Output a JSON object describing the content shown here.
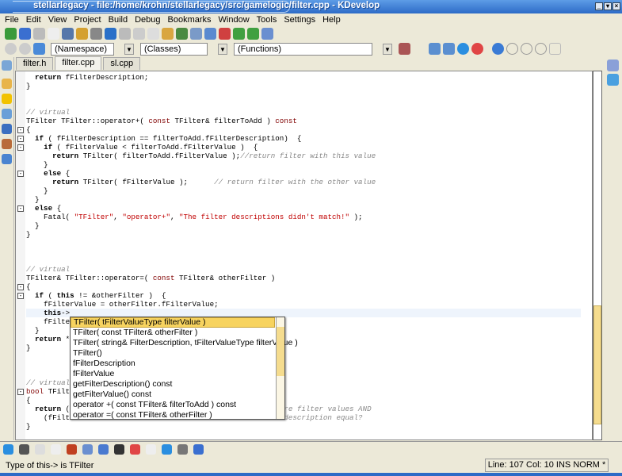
{
  "window": {
    "title": "stellarlegacy - file:/home/krohn/stellarlegacy/src/gamelogic/filter.cpp - KDevelop"
  },
  "menu": [
    "File",
    "Edit",
    "View",
    "Project",
    "Build",
    "Debug",
    "Bookmarks",
    "Window",
    "Tools",
    "Settings",
    "Help"
  ],
  "toolbar2": {
    "namespace": "(Namespace)",
    "classes": "(Classes)",
    "functions": "(Functions)"
  },
  "tabs": [
    {
      "label": "filter.h"
    },
    {
      "label": "filter.cpp",
      "active": true
    },
    {
      "label": "sl.cpp"
    }
  ],
  "code": [
    [
      [
        "  ",
        "pl"
      ],
      [
        "return",
        "kw"
      ],
      [
        " fFilterDescription;",
        "pl"
      ]
    ],
    [
      [
        "}",
        "pl"
      ]
    ],
    [],
    [],
    [
      [
        "// virtual",
        "cm"
      ]
    ],
    [
      [
        "TFilter TFilter::operator+( ",
        "pl"
      ],
      [
        "const",
        "ty"
      ],
      [
        " TFilter& filterToAdd ) ",
        "pl"
      ],
      [
        "const",
        "ty"
      ]
    ],
    [
      [
        "{",
        "pl"
      ]
    ],
    [
      [
        "  ",
        "pl"
      ],
      [
        "if",
        "kw"
      ],
      [
        " ( fFilterDescription == filterToAdd.fFilterDescription)  {",
        "pl"
      ]
    ],
    [
      [
        "    ",
        "pl"
      ],
      [
        "if",
        "kw"
      ],
      [
        " ( fFilterValue < filterToAdd.fFilterValue )  {",
        "pl"
      ]
    ],
    [
      [
        "      ",
        "pl"
      ],
      [
        "return",
        "kw"
      ],
      [
        " TFilter( filterToAdd.fFilterValue );",
        "pl"
      ],
      [
        "//return filter with this value",
        "cm"
      ]
    ],
    [
      [
        "    }",
        "pl"
      ]
    ],
    [
      [
        "    ",
        "pl"
      ],
      [
        "else",
        "kw"
      ],
      [
        " {",
        "pl"
      ]
    ],
    [
      [
        "      ",
        "pl"
      ],
      [
        "return",
        "kw"
      ],
      [
        " TFilter( fFilterValue );      ",
        "pl"
      ],
      [
        "// return filter with the other value",
        "cm"
      ]
    ],
    [
      [
        "    }",
        "pl"
      ]
    ],
    [
      [
        "  }",
        "pl"
      ]
    ],
    [
      [
        "  ",
        "pl"
      ],
      [
        "else",
        "kw"
      ],
      [
        " {",
        "pl"
      ]
    ],
    [
      [
        "    Fatal( ",
        "pl"
      ],
      [
        "\"TFilter\"",
        "st"
      ],
      [
        ", ",
        "pl"
      ],
      [
        "\"operator+\"",
        "st"
      ],
      [
        ", ",
        "pl"
      ],
      [
        "\"The filter descriptions didn't match!\"",
        "st"
      ],
      [
        " );",
        "pl"
      ]
    ],
    [
      [
        "  }",
        "pl"
      ]
    ],
    [
      [
        "}",
        "pl"
      ]
    ],
    [],
    [],
    [],
    [
      [
        "// virtual",
        "cm"
      ]
    ],
    [
      [
        "TFilter& TFilter::operator=( ",
        "pl"
      ],
      [
        "const",
        "ty"
      ],
      [
        " TFilter& otherFilter )",
        "pl"
      ]
    ],
    [
      [
        "{",
        "pl"
      ]
    ],
    [
      [
        "  ",
        "pl"
      ],
      [
        "if",
        "kw"
      ],
      [
        " ( ",
        "pl"
      ],
      [
        "this",
        "kw"
      ],
      [
        " != &otherFilter )  {",
        "pl"
      ]
    ],
    [
      [
        "    fFilterValue = otherFilter.fFilterValue;",
        "pl"
      ]
    ],
    [
      [
        "    ",
        "pl"
      ],
      [
        "this",
        "kw"
      ],
      [
        "->",
        "pl"
      ]
    ],
    [
      [
        "    fFilte",
        "pl"
      ]
    ],
    [
      [
        "  }",
        "pl"
      ]
    ],
    [
      [
        "  ",
        "pl"
      ],
      [
        "return",
        "kw"
      ],
      [
        " *",
        "pl"
      ]
    ],
    [
      [
        "}",
        "pl"
      ]
    ],
    [],
    [],
    [],
    [
      [
        "// virtual",
        "cm"
      ]
    ],
    [
      [
        "bool",
        "ty"
      ],
      [
        " TFilt",
        "pl"
      ]
    ],
    [
      [
        "{",
        "pl"
      ]
    ],
    [
      [
        "  ",
        "pl"
      ],
      [
        "return",
        "kw"
      ],
      [
        " (                                                ",
        "pl"
      ],
      [
        "are filter values AND",
        "cm"
      ]
    ],
    [
      [
        "    (fFilt                                               ",
        "pl"
      ],
      [
        "//description equal?",
        "cm"
      ]
    ],
    [
      [
        "}",
        "pl"
      ]
    ]
  ],
  "current_line": 27,
  "completion": {
    "items": [
      "TFilter( tFilterValueType filterValue )",
      "TFilter( const TFilter& otherFilter )",
      "TFilter( string& FilterDescription, tFilterValueType filterValue )",
      "TFilter()",
      "fFilterDescription",
      "fFilterValue",
      "getFilterDescription()  const",
      "getFilterValue()  const",
      "operator +( const TFilter& filterToAdd ) const",
      "operator =( const TFilter& otherFilter )"
    ],
    "selected": 0
  },
  "status": {
    "message": "Type of this-> is TFilter",
    "position": "Line: 107 Col: 10  INS  NORM  *"
  },
  "colors": {
    "titlebar": "#2d6bc7",
    "highlight": "#f7d35f",
    "keyword_type": "#800000",
    "string": "#c00000",
    "comment": "#888888"
  }
}
